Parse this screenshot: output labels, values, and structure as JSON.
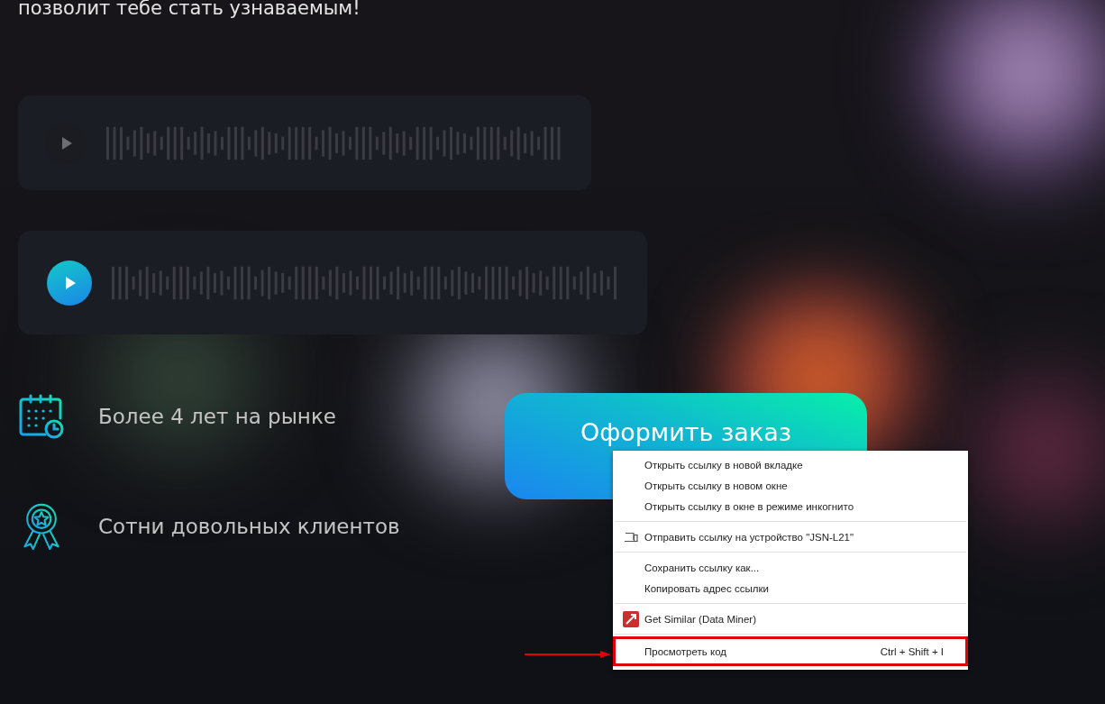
{
  "intro_text": "позволит тебе стать узнаваемым!",
  "audio_players": [
    {
      "active": false
    },
    {
      "active": true
    }
  ],
  "features": [
    {
      "kind": "calendar",
      "text": "Более 4 лет на рынке"
    },
    {
      "kind": "award",
      "text": "Сотни довольных клиентов"
    }
  ],
  "order_button": {
    "label": "Оформить заказ"
  },
  "context_menu": {
    "groups": [
      [
        {
          "label": "Открыть ссылку в новой вкладке",
          "highlighted": false
        },
        {
          "label": "Открыть ссылку в новом окне",
          "highlighted": false
        },
        {
          "label": "Открыть ссылку в окне в режиме инкогнито",
          "highlighted": false
        }
      ],
      [
        {
          "label": "Отправить ссылку на устройство \"JSN-L21\"",
          "kind": "device",
          "highlighted": false
        }
      ],
      [
        {
          "label": "Сохранить ссылку как...",
          "highlighted": false
        },
        {
          "label": "Копировать адрес ссылки",
          "highlighted": false
        }
      ],
      [
        {
          "label": "Get Similar (Data Miner)",
          "kind": "miner",
          "highlighted": false
        }
      ],
      [
        {
          "label": "Просмотреть код",
          "shortcut": "Ctrl + Shift + I",
          "highlighted": true
        }
      ]
    ]
  }
}
